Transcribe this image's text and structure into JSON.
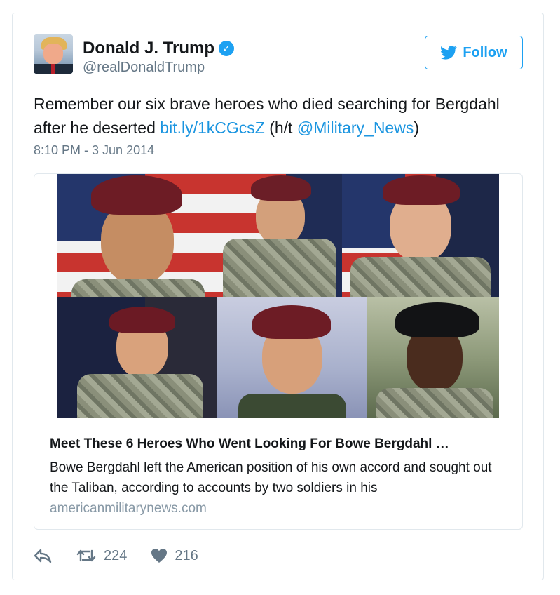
{
  "author": {
    "name": "Donald J. Trump",
    "verified_icon": "verified-badge-icon",
    "handle": "@realDonaldTrump",
    "follow_label": "Follow"
  },
  "tweet": {
    "text_part1": "Remember our six brave heroes who died searching for Bergdahl after he deserted ",
    "link": "bit.ly/1kCGcsZ",
    "text_part2": " (h/t ",
    "mention": "@Military_News",
    "text_part3": ")",
    "timestamp": "8:10 PM - 3 Jun 2014"
  },
  "card": {
    "title": "Meet These 6 Heroes Who Went Looking For Bowe Bergdahl …",
    "description": "Bowe Bergdahl left the American position of his own accord and sought out the Taliban, according to accounts by two soldiers in his",
    "domain": "americanmilitarynews.com"
  },
  "actions": {
    "reply_icon": "reply-icon",
    "retweet_icon": "retweet-icon",
    "retweet_count": "224",
    "like_icon": "heart-icon",
    "like_count": "216"
  },
  "colors": {
    "accent": "#1da1f2",
    "link": "#1b95e0",
    "muted": "#657786",
    "border": "#e1e8ed"
  }
}
